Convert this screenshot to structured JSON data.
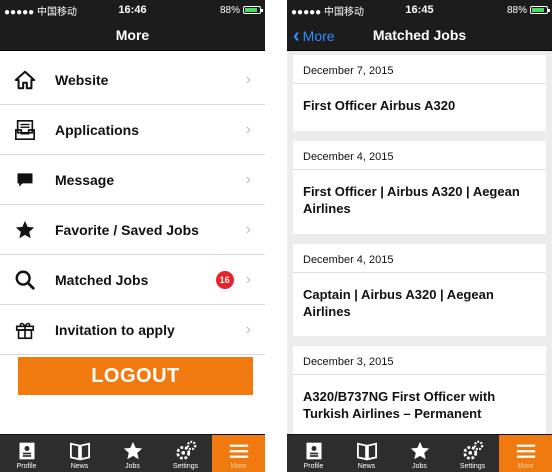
{
  "left_screen": {
    "status": {
      "carrier": "●●●●● 中国移动",
      "time": "16:46",
      "battery": "88%",
      "battery_level": 0.88
    },
    "nav": {
      "title": "More"
    },
    "menu": [
      {
        "label": "Website",
        "icon": "home-icon"
      },
      {
        "label": "Applications",
        "icon": "applications-icon"
      },
      {
        "label": "Message",
        "icon": "message-icon"
      },
      {
        "label": "Favorite / Saved Jobs",
        "icon": "star-icon"
      },
      {
        "label": "Matched Jobs",
        "icon": "search-icon",
        "badge": "16"
      },
      {
        "label": "Invitation to apply",
        "icon": "gift-icon"
      }
    ],
    "logout_label": "LOGOUT"
  },
  "right_screen": {
    "status": {
      "carrier": "●●●●● 中国移动",
      "time": "16:45",
      "battery": "88%",
      "battery_level": 0.88
    },
    "nav": {
      "back_label": "More",
      "title": "Matched Jobs"
    },
    "jobs": [
      {
        "date": "December 7, 2015",
        "title": "First Officer Airbus A320"
      },
      {
        "date": "December 4, 2015",
        "title": "First Officer | Airbus A320 | Aegean Airlines"
      },
      {
        "date": "December 4, 2015",
        "title": "Captain | Airbus A320 | Aegean Airlines"
      },
      {
        "date": "December 3, 2015",
        "title": "A320/B737NG First Officer with Turkish Airlines – Permanent"
      }
    ]
  },
  "tabbar": {
    "tabs": [
      {
        "label": "Profile",
        "icon": "profile-icon"
      },
      {
        "label": "News",
        "icon": "news-book-icon"
      },
      {
        "label": "Jobs",
        "icon": "star-icon"
      },
      {
        "label": "Settings",
        "icon": "gears-icon"
      },
      {
        "label": "More",
        "icon": "menu-icon",
        "active": true
      }
    ]
  },
  "colors": {
    "accent": "#f07a10",
    "badge": "#e8232a",
    "bar": "#1c1c1c",
    "link": "#2f8fff"
  }
}
